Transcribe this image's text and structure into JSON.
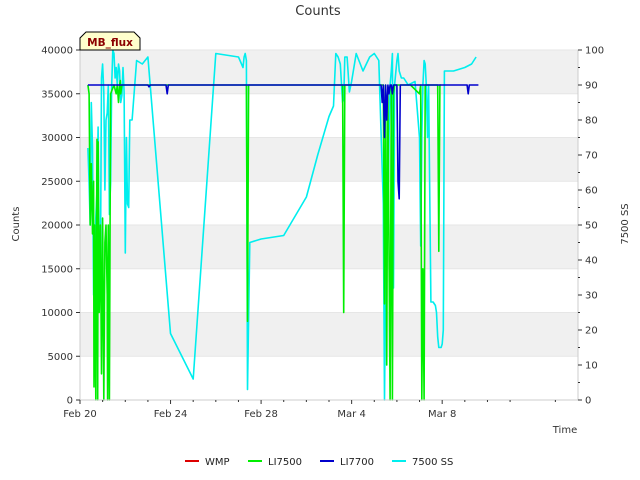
{
  "chart_data": {
    "type": "line",
    "title": "Counts",
    "xlabel": "Time",
    "ylabel": "Counts",
    "y2label": "7500 SS",
    "badge": "MB_flux",
    "xlim": [
      0,
      22
    ],
    "ylim": [
      0,
      40000
    ],
    "y2lim": [
      0,
      100
    ],
    "x_ticks": [
      {
        "value": 0,
        "label": "Feb 20"
      },
      {
        "value": 4,
        "label": "Feb 24"
      },
      {
        "value": 8,
        "label": "Feb 28"
      },
      {
        "value": 12,
        "label": "Mar 4"
      },
      {
        "value": 16,
        "label": "Mar 8"
      }
    ],
    "y_ticks": [
      0,
      5000,
      10000,
      15000,
      20000,
      25000,
      30000,
      35000,
      40000
    ],
    "y2_ticks": [
      0,
      10,
      20,
      30,
      40,
      50,
      60,
      70,
      80,
      90,
      100
    ],
    "grid": "horizontal-bands",
    "legend_position": "bottom-center",
    "series": [
      {
        "name": "WMP",
        "color": "#dd0000",
        "axis": "left",
        "x": [],
        "y": []
      },
      {
        "name": "LI7500",
        "color": "#00ee00",
        "axis": "left",
        "x": [
          0.35,
          0.4,
          0.45,
          0.5,
          0.55,
          0.6,
          0.62,
          0.65,
          0.7,
          0.72,
          0.75,
          0.78,
          0.8,
          0.85,
          0.9,
          0.95,
          1.0,
          1.05,
          1.08,
          1.1,
          1.15,
          1.2,
          1.22,
          1.25,
          1.3,
          1.35,
          1.5,
          1.6,
          1.65,
          1.7,
          1.75,
          1.78,
          1.8,
          1.85,
          1.9,
          2.0,
          7.3,
          7.35,
          7.4,
          7.45,
          7.5,
          11.6,
          11.65,
          11.7,
          11.75,
          11.8,
          13.4,
          13.45,
          13.5,
          13.55,
          13.6,
          13.65,
          13.7,
          13.75,
          13.8,
          13.85,
          13.9,
          14.0,
          14.05,
          14.1,
          14.15,
          14.2,
          14.25,
          14.3,
          14.35,
          14.4,
          14.5,
          14.6,
          15.0,
          15.05,
          15.1,
          15.15,
          15.2,
          15.25,
          15.3,
          15.35,
          15.5,
          15.6,
          15.8,
          15.85,
          15.9,
          15.95
        ],
        "y": [
          36000,
          35000,
          20000,
          27000,
          19000,
          25000,
          1500,
          20000,
          0,
          16000,
          29800,
          0,
          29500,
          10000,
          20000,
          3000,
          20800,
          0,
          10000,
          18000,
          20000,
          12000,
          0,
          20000,
          0,
          35000,
          36000,
          35000,
          36000,
          34000,
          36000,
          36500,
          35000,
          36000,
          36000,
          36000,
          36000,
          36000,
          9000,
          36000,
          36000,
          36000,
          10000,
          36000,
          36000,
          36000,
          36000,
          11000,
          36000,
          4000,
          35000,
          17000,
          0,
          36000,
          0,
          35000,
          36000,
          36000,
          36000,
          36000,
          36000,
          36000,
          36000,
          36000,
          36000,
          36000,
          36000,
          36000,
          35000,
          36000,
          0,
          15000,
          0,
          36000,
          36000,
          36000,
          36000,
          36000,
          36000,
          17000,
          36000,
          36000
        ]
      },
      {
        "name": "LI7700",
        "color": "#0000cc",
        "axis": "left",
        "x": [
          0.35,
          3.0,
          3.05,
          3.1,
          3.2,
          3.8,
          3.85,
          3.9,
          4.0,
          13.3,
          13.35,
          13.4,
          13.45,
          13.5,
          13.55,
          13.6,
          13.65,
          13.7,
          13.75,
          13.8,
          13.85,
          13.9,
          14.0,
          14.05,
          14.1,
          14.15,
          14.2,
          14.25,
          14.3,
          15.0,
          17.1,
          17.15,
          17.2,
          17.3,
          17.4,
          17.6
        ],
        "y": [
          36000,
          36000,
          35800,
          36000,
          36000,
          36000,
          35000,
          36000,
          36000,
          36000,
          34000,
          36000,
          30000,
          36000,
          32000,
          36000,
          35000,
          36000,
          36000,
          35000,
          36000,
          36000,
          36000,
          25000,
          23000,
          36000,
          36000,
          36000,
          36000,
          36000,
          36000,
          35000,
          36000,
          36000,
          36000,
          36000
        ]
      },
      {
        "name": "7500 SS",
        "color": "#00eeee",
        "axis": "right",
        "x": [
          0.35,
          0.4,
          0.45,
          0.5,
          0.55,
          0.6,
          0.65,
          0.7,
          0.75,
          0.8,
          0.85,
          0.9,
          0.95,
          1.0,
          1.05,
          1.1,
          1.15,
          1.2,
          1.25,
          1.3,
          1.35,
          1.4,
          1.45,
          1.5,
          1.55,
          1.6,
          1.65,
          1.7,
          1.75,
          1.8,
          1.85,
          1.9,
          1.95,
          2.0,
          2.05,
          2.1,
          2.15,
          2.2,
          2.3,
          2.5,
          2.75,
          3.0,
          4.0,
          5.0,
          6.0,
          7.0,
          7.2,
          7.25,
          7.3,
          7.35,
          7.4,
          7.5,
          8.0,
          9.0,
          10.0,
          10.5,
          11.0,
          11.2,
          11.3,
          11.4,
          11.5,
          11.6,
          11.65,
          11.7,
          11.75,
          11.8,
          11.9,
          12.0,
          12.2,
          12.5,
          12.8,
          13.0,
          13.2,
          13.4,
          13.45,
          13.5,
          13.55,
          13.6,
          13.65,
          13.7,
          13.75,
          13.8,
          13.85,
          13.9,
          14.0,
          14.05,
          14.1,
          14.2,
          14.3,
          14.5,
          14.8,
          15.0,
          15.05,
          15.1,
          15.15,
          15.2,
          15.25,
          15.3,
          15.35,
          15.4,
          15.5,
          15.6,
          15.7,
          15.75,
          15.8,
          15.85,
          15.9,
          15.95,
          16.0,
          16.05,
          16.1,
          16.2,
          16.5,
          17.0,
          17.3,
          17.5
        ],
        "y": [
          72,
          62,
          50,
          85,
          72,
          30,
          40,
          52,
          60,
          78,
          40,
          36,
          92,
          96,
          88,
          60,
          80,
          82,
          90,
          53,
          62,
          90,
          100,
          99,
          92,
          95,
          90,
          96,
          94,
          85,
          87,
          95,
          88,
          42,
          75,
          56,
          55,
          80,
          80,
          97,
          96,
          98,
          19,
          6,
          99,
          98,
          95,
          98,
          99,
          97,
          3,
          45,
          46,
          47,
          58,
          70,
          81,
          84,
          99,
          98,
          96,
          85,
          86,
          98,
          98,
          98,
          88,
          91,
          99,
          94,
          98,
          99,
          97,
          56,
          0,
          35,
          40,
          55,
          75,
          90,
          94,
          99,
          32,
          90,
          97,
          99,
          94,
          92,
          92,
          90,
          91,
          75,
          44,
          75,
          90,
          97,
          96,
          90,
          75,
          90,
          28,
          28,
          27,
          25,
          18,
          15,
          15,
          15,
          16,
          20,
          94,
          94,
          94,
          95,
          96,
          98
        ]
      }
    ]
  },
  "legend": {
    "items": [
      {
        "name": "WMP",
        "color": "#dd0000"
      },
      {
        "name": "LI7500",
        "color": "#00ee00"
      },
      {
        "name": "LI7700",
        "color": "#0000cc"
      },
      {
        "name": "7500 SS",
        "color": "#00eeee"
      }
    ]
  }
}
